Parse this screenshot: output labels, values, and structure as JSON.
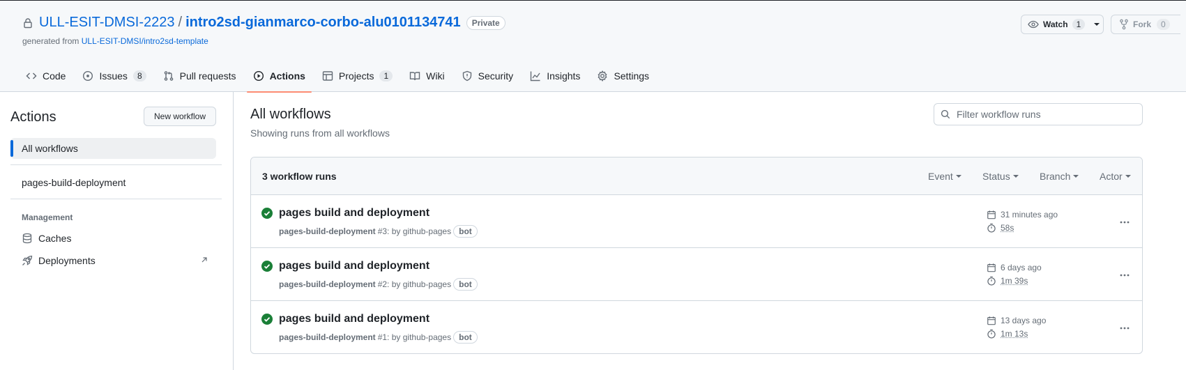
{
  "repo": {
    "owner": "ULL-ESIT-DMSI-2223",
    "separator": "/",
    "name": "intro2sd-gianmarco-corbo-alu0101134741",
    "visibility": "Private",
    "generated_prefix": "generated from",
    "template": "ULL-ESIT-DMSI/intro2sd-template"
  },
  "header_actions": {
    "watch_label": "Watch",
    "watch_count": "1",
    "fork_label": "Fork",
    "fork_count": "0"
  },
  "nav": {
    "code": "Code",
    "issues": "Issues",
    "issues_count": "8",
    "pulls": "Pull requests",
    "actions": "Actions",
    "projects": "Projects",
    "projects_count": "1",
    "wiki": "Wiki",
    "security": "Security",
    "insights": "Insights",
    "settings": "Settings"
  },
  "sidebar": {
    "title": "Actions",
    "new_workflow": "New workflow",
    "all_workflows": "All workflows",
    "workflow": "pages-build-deployment",
    "management_heading": "Management",
    "caches": "Caches",
    "deployments": "Deployments"
  },
  "main": {
    "title": "All workflows",
    "subtitle": "Showing runs from all workflows",
    "filter_placeholder": "Filter workflow runs",
    "runs_count": "3 workflow runs",
    "filters": {
      "event": "Event",
      "status": "Status",
      "branch": "Branch",
      "actor": "Actor"
    },
    "runs": [
      {
        "title": "pages build and deployment",
        "workflow": "pages-build-deployment",
        "number": "#3",
        "by": ": by github-pages",
        "badge": "bot",
        "time": "31 minutes ago",
        "duration": "58s",
        "status": "success"
      },
      {
        "title": "pages build and deployment",
        "workflow": "pages-build-deployment",
        "number": "#2",
        "by": ": by github-pages",
        "badge": "bot",
        "time": "6 days ago",
        "duration": "1m 39s",
        "status": "success"
      },
      {
        "title": "pages build and deployment",
        "workflow": "pages-build-deployment",
        "number": "#1",
        "by": ": by github-pages",
        "badge": "bot",
        "time": "13 days ago",
        "duration": "1m 13s",
        "status": "success"
      }
    ]
  },
  "colors": {
    "link": "#0969da",
    "success": "#1a7f37",
    "active_tab_underline": "#fd8c73",
    "sidebar_active_bar": "#0969da"
  }
}
